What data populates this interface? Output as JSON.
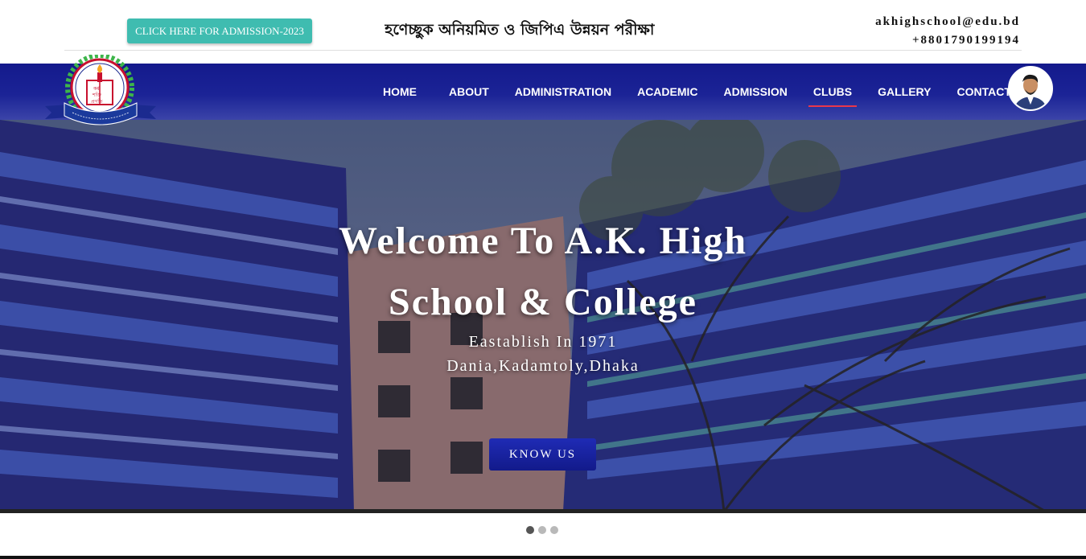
{
  "topbar": {
    "admission_button": "CLICK HERE FOR ADMISSION-2023",
    "marquee_text": "গ্রহণেচ্ছুক অনিয়মিত ও জিপিএ উন্নয়ন পরীক্ষা",
    "email": "akhighschool@edu.bd",
    "phone": "+8801790199194"
  },
  "nav": {
    "items": [
      {
        "label": "HOME",
        "active": false
      },
      {
        "label": "ABOUT",
        "active": false
      },
      {
        "label": "ADMINISTRATION",
        "active": false
      },
      {
        "label": "ACADEMIC",
        "active": false
      },
      {
        "label": "ADMISSION",
        "active": false
      },
      {
        "label": "CLUBS",
        "active": true
      },
      {
        "label": "GALLERY",
        "active": false
      },
      {
        "label": "CONTACT",
        "active": false
      }
    ],
    "active_underline_color": "#e8374b",
    "bar_color": "#1b2396"
  },
  "hero": {
    "title_line1": "Welcome To A.K. High",
    "title_line2": "School & College",
    "subtitle1": "Eastablish In 1971",
    "subtitle2": "Dania,Kadamtoly,Dhaka",
    "cta": "KNOW US"
  },
  "carousel": {
    "slide_count": 3,
    "active_index": 0
  },
  "icons": {
    "logo": "school-crest-logo",
    "avatar": "profile-avatar"
  },
  "colors": {
    "admission_button": "#3fbcb0",
    "cta_button": "#121a8a"
  }
}
